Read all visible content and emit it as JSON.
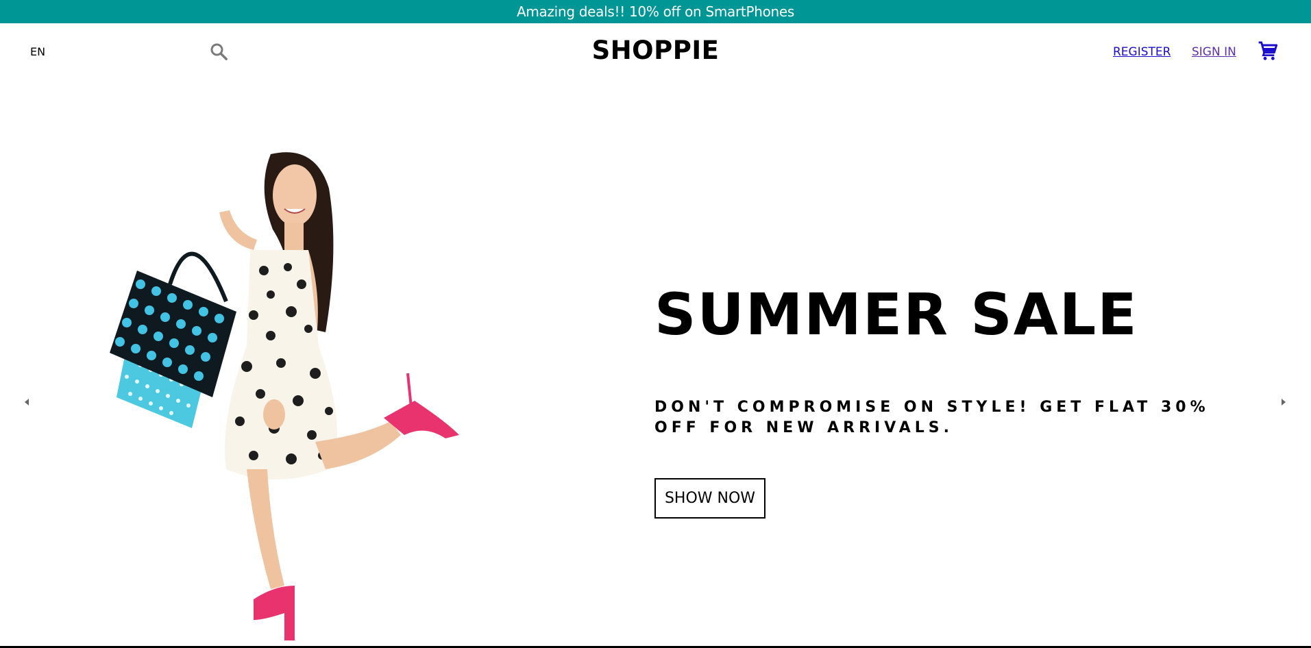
{
  "announcement": {
    "text": "Amazing deals!! 10% off on SmartPhones",
    "background_color": "#009696"
  },
  "navbar": {
    "language": "EN",
    "search_icon": "search-icon",
    "logo": "SHOPPIE",
    "register_label": "REGISTER",
    "signin_label": "SIGN IN",
    "cart_icon": "shopping-cart-icon",
    "cart_color": "#1a0dcc"
  },
  "hero": {
    "title": "SUMMER SALE",
    "subtitle": "DON'T COMPROMISE ON STYLE! GET FLAT 30% OFF FOR NEW ARRIVALS.",
    "cta_label": "SHOW NOW",
    "image_icon": "woman-with-shopping-bags-image",
    "prev_icon": "arrow-left-icon",
    "next_icon": "arrow-right-icon"
  }
}
